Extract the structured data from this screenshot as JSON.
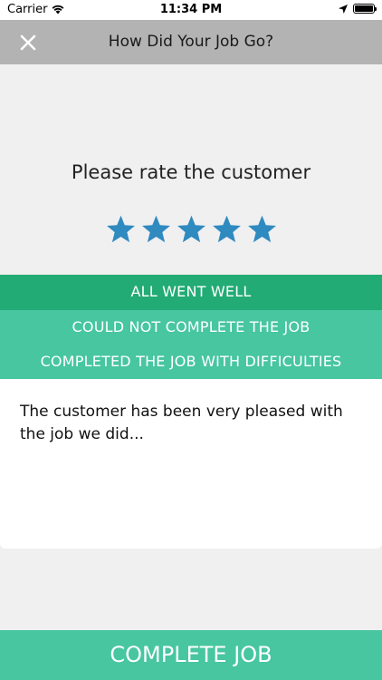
{
  "status_bar": {
    "carrier": "Carrier",
    "time": "11:34 PM",
    "battery_level": 1.0
  },
  "header": {
    "title": "How Did Your Job Go?",
    "close_icon": "close-icon"
  },
  "rating": {
    "prompt": "Please rate the customer",
    "value": 5,
    "max": 5,
    "star_color": "#2f8ac0"
  },
  "outcomes": {
    "options": [
      "ALL WENT WELL",
      "COULD NOT COMPLETE THE JOB",
      "COMPLETED THE JOB WITH DIFFICULTIES"
    ],
    "selected_index": 0,
    "selected_color": "#22ab75",
    "option_color": "#47c69f"
  },
  "comment": {
    "text": "The customer has been very pleased with the job we did..."
  },
  "footer": {
    "complete_label": "COMPLETE JOB"
  }
}
